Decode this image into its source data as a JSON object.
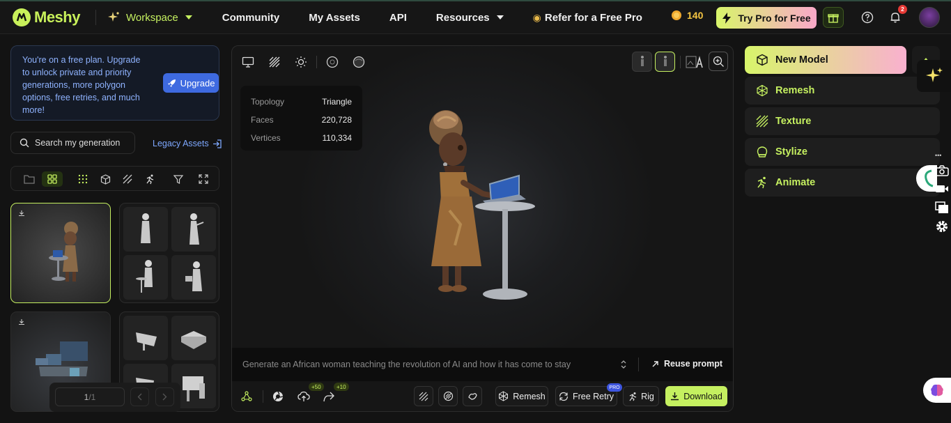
{
  "header": {
    "brand": "Meshy",
    "nav": [
      "Workspace",
      "Community",
      "My Assets",
      "API",
      "Resources",
      "Refer for a Free Pro"
    ],
    "credits": "140",
    "try_pro": "Try Pro for Free",
    "notification_count": "2"
  },
  "sidebar": {
    "upgrade_message": "You're on a free plan. Upgrade to unlock private and priority generations, more polygon options, free retries, and much more!",
    "upgrade_button": "Upgrade",
    "search_placeholder": "Search my generation",
    "legacy_assets": "Legacy Assets",
    "pager": {
      "page": "1",
      "total": "/1"
    }
  },
  "viewer": {
    "stats": [
      {
        "label": "Topology",
        "value": "Triangle"
      },
      {
        "label": "Faces",
        "value": "220,728"
      },
      {
        "label": "Vertices",
        "value": "110,334"
      }
    ],
    "prompt": "Generate an African woman teaching the revolution of AI and how it has come to stay",
    "reuse_prompt": "Reuse prompt",
    "badges": {
      "upload": "+50",
      "share": "+10",
      "pro": "PRO"
    },
    "actions": {
      "remesh": "Remesh",
      "free_retry": "Free Retry",
      "rig": "Rig",
      "download": "Download"
    }
  },
  "tools": [
    "New Model",
    "Remesh",
    "Texture",
    "Stylize",
    "Animate"
  ],
  "colors": {
    "accent": "#c5f060",
    "blue": "#3e6ae0",
    "badge_red": "#e53935",
    "pro_gradient_end": "#f9a8c9"
  }
}
